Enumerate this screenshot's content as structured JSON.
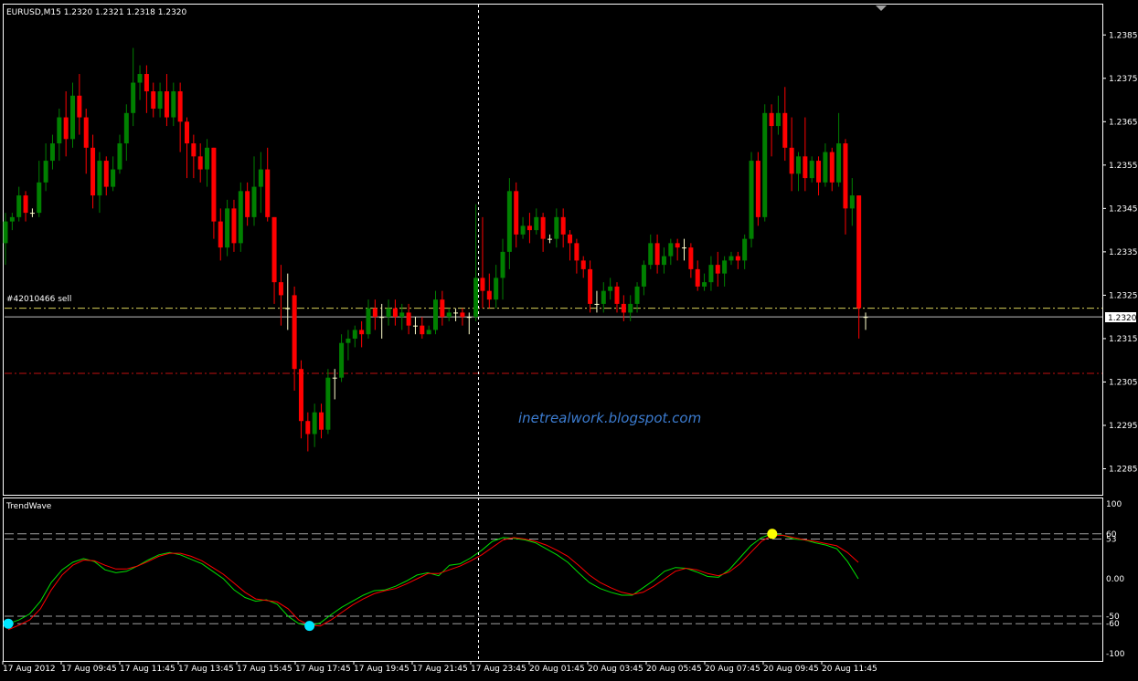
{
  "window": {
    "symbol_label": "EURUSD,M15  1.2320 1.2321 1.2318 1.2320",
    "order_label": "#42010466 sell",
    "price_tag": "1.2320",
    "watermark": "inetrealwork.blogspot.com",
    "indicator_label": "TrendWave"
  },
  "colors": {
    "background": "#000000",
    "frame": "#ffffff",
    "bull_candle": "#008000",
    "bear_candle": "#ff0000",
    "doji": "#ffffcc",
    "order_line": "#d6d05a",
    "stop_line": "#c01010",
    "bid_line": "#c0c0c0",
    "crosshair": "#ffffff",
    "watermark": "#3c7cd0",
    "wave_fast": "#00e000",
    "wave_slow": "#ff0000",
    "level_line": "#a0a0a0",
    "buy_dot": "#00e5ff",
    "sell_dot": "#ffff00"
  },
  "chart_data": [
    {
      "type": "candlestick",
      "title": "EURUSD,M15  1.2320 1.2321 1.2318 1.2320",
      "ylim": [
        1.2279,
        1.2392
      ],
      "y_ticks": [
        "1.2385",
        "1.2375",
        "1.2365",
        "1.2355",
        "1.2345",
        "1.2335",
        "1.2325",
        "1.2315",
        "1.2305",
        "1.2295",
        "1.2285"
      ],
      "x_tick_labels": [
        "17 Aug 2012",
        "17 Aug 09:45",
        "17 Aug 11:45",
        "17 Aug 13:45",
        "17 Aug 15:45",
        "17 Aug 17:45",
        "17 Aug 19:45",
        "17 Aug 21:45",
        "17 Aug 23:45",
        "20 Aug 01:45",
        "20 Aug 03:45",
        "20 Aug 05:45",
        "20 Aug 07:45",
        "20 Aug 09:45",
        "20 Aug 11:45"
      ],
      "levels": {
        "order_sell": 1.2322,
        "stop": 1.2307,
        "bid": 1.232
      },
      "candles": [
        [
          1.2337,
          1.2342,
          1.2332,
          1.2344
        ],
        [
          1.2342,
          1.2343,
          1.234,
          1.2344
        ],
        [
          1.2343,
          1.2348,
          1.2342,
          1.235
        ],
        [
          1.2348,
          1.2344,
          1.2342,
          1.2349
        ],
        [
          1.2344,
          1.2344,
          1.2343,
          1.2345
        ],
        [
          1.2344,
          1.2351,
          1.2343,
          1.2356
        ],
        [
          1.2351,
          1.2356,
          1.2349,
          1.236
        ],
        [
          1.2356,
          1.236,
          1.2354,
          1.2362
        ],
        [
          1.236,
          1.2366,
          1.2356,
          1.2368
        ],
        [
          1.2366,
          1.2361,
          1.2357,
          1.2372
        ],
        [
          1.2361,
          1.2371,
          1.2359,
          1.2374
        ],
        [
          1.2371,
          1.2366,
          1.2362,
          1.2376
        ],
        [
          1.2366,
          1.2359,
          1.2353,
          1.2368
        ],
        [
          1.2359,
          1.2348,
          1.2345,
          1.2362
        ],
        [
          1.2348,
          1.2356,
          1.2344,
          1.2358
        ],
        [
          1.2356,
          1.235,
          1.2348,
          1.2357
        ],
        [
          1.235,
          1.2354,
          1.2349,
          1.2357
        ],
        [
          1.2354,
          1.236,
          1.2353,
          1.2362
        ],
        [
          1.236,
          1.2367,
          1.2356,
          1.2369
        ],
        [
          1.2367,
          1.2374,
          1.2364,
          1.2382
        ],
        [
          1.2374,
          1.2376,
          1.237,
          1.2378
        ],
        [
          1.2376,
          1.2372,
          1.2367,
          1.2378
        ],
        [
          1.2372,
          1.2368,
          1.2366,
          1.2374
        ],
        [
          1.2368,
          1.2372,
          1.2366,
          1.2374
        ],
        [
          1.2372,
          1.2366,
          1.2364,
          1.2376
        ],
        [
          1.2366,
          1.2372,
          1.2364,
          1.2374
        ],
        [
          1.2372,
          1.2365,
          1.2358,
          1.2374
        ],
        [
          1.2365,
          1.236,
          1.2352,
          1.2366
        ],
        [
          1.236,
          1.2357,
          1.2352,
          1.2362
        ],
        [
          1.2357,
          1.2354,
          1.2351,
          1.236
        ],
        [
          1.2354,
          1.2359,
          1.235,
          1.2361
        ],
        [
          1.2359,
          1.2342,
          1.2338,
          1.2359
        ],
        [
          1.2342,
          1.2336,
          1.2333,
          1.2345
        ],
        [
          1.2336,
          1.2345,
          1.2334,
          1.2347
        ],
        [
          1.2345,
          1.2337,
          1.2335,
          1.2347
        ],
        [
          1.2337,
          1.2349,
          1.2335,
          1.2351
        ],
        [
          1.2349,
          1.2343,
          1.2341,
          1.2351
        ],
        [
          1.2343,
          1.235,
          1.2341,
          1.2357
        ],
        [
          1.235,
          1.2354,
          1.2344,
          1.2358
        ],
        [
          1.2354,
          1.2343,
          1.2342,
          1.2359
        ],
        [
          1.2343,
          1.2328,
          1.2323,
          1.2343
        ],
        [
          1.2328,
          1.2325,
          1.2318,
          1.2332
        ],
        [
          1.2322,
          1.2322,
          1.2317,
          1.233
        ],
        [
          1.2325,
          1.2308,
          1.2303,
          1.2327
        ],
        [
          1.2308,
          1.2296,
          1.2292,
          1.231
        ],
        [
          1.2296,
          1.2293,
          1.2289,
          1.2298
        ],
        [
          1.2293,
          1.2298,
          1.229,
          1.23
        ],
        [
          1.2298,
          1.2294,
          1.2292,
          1.23
        ],
        [
          1.2294,
          1.2306,
          1.2293,
          1.2308
        ],
        [
          1.2306,
          1.2306,
          1.2301,
          1.2308
        ],
        [
          1.2306,
          1.2314,
          1.2305,
          1.2316
        ],
        [
          1.2314,
          1.2315,
          1.231,
          1.2317
        ],
        [
          1.2315,
          1.2317,
          1.2313,
          1.2318
        ],
        [
          1.2317,
          1.2316,
          1.2313,
          1.2319
        ],
        [
          1.2316,
          1.2322,
          1.2315,
          1.2324
        ],
        [
          1.2322,
          1.232,
          1.2317,
          1.2324
        ],
        [
          1.232,
          1.232,
          1.2315,
          1.2323
        ],
        [
          1.232,
          1.2322,
          1.2318,
          1.2324
        ],
        [
          1.2322,
          1.232,
          1.2318,
          1.2324
        ],
        [
          1.232,
          1.2321,
          1.2317,
          1.2323
        ],
        [
          1.2321,
          1.2318,
          1.2316,
          1.2323
        ],
        [
          1.2318,
          1.2318,
          1.2316,
          1.232
        ],
        [
          1.2318,
          1.2316,
          1.2315,
          1.232
        ],
        [
          1.2316,
          1.2317,
          1.2316,
          1.2318
        ],
        [
          1.2317,
          1.2324,
          1.2316,
          1.2326
        ],
        [
          1.2324,
          1.232,
          1.2318,
          1.2326
        ],
        [
          1.232,
          1.2321,
          1.2319,
          1.2322
        ],
        [
          1.2321,
          1.2321,
          1.2319,
          1.2322
        ],
        [
          1.2321,
          1.232,
          1.2318,
          1.2322
        ],
        [
          1.232,
          1.232,
          1.2316,
          1.2321
        ],
        [
          1.232,
          1.2329,
          1.2319,
          1.2346
        ],
        [
          1.2329,
          1.2326,
          1.2322,
          1.2343
        ],
        [
          1.2326,
          1.2324,
          1.2322,
          1.233
        ],
        [
          1.2324,
          1.2329,
          1.2322,
          1.2332
        ],
        [
          1.2329,
          1.2335,
          1.2324,
          1.2338
        ],
        [
          1.2335,
          1.2349,
          1.2331,
          1.2352
        ],
        [
          1.2349,
          1.2339,
          1.2336,
          1.2351
        ],
        [
          1.2339,
          1.2341,
          1.2338,
          1.2343
        ],
        [
          1.2341,
          1.234,
          1.2337,
          1.2344
        ],
        [
          1.234,
          1.2343,
          1.2339,
          1.2345
        ],
        [
          1.2343,
          1.2338,
          1.2335,
          1.2344
        ],
        [
          1.2338,
          1.2338,
          1.2337,
          1.2339
        ],
        [
          1.2338,
          1.2343,
          1.2336,
          1.2345
        ],
        [
          1.2343,
          1.2339,
          1.2336,
          1.2345
        ],
        [
          1.2339,
          1.2337,
          1.2333,
          1.234
        ],
        [
          1.2337,
          1.2333,
          1.233,
          1.2338
        ],
        [
          1.2333,
          1.2331,
          1.2329,
          1.2334
        ],
        [
          1.2331,
          1.2323,
          1.2321,
          1.2333
        ],
        [
          1.2323,
          1.2323,
          1.2321,
          1.2326
        ],
        [
          1.2323,
          1.2326,
          1.2321,
          1.2328
        ],
        [
          1.2326,
          1.2327,
          1.2324,
          1.2329
        ],
        [
          1.2327,
          1.2323,
          1.2321,
          1.2328
        ],
        [
          1.2323,
          1.2321,
          1.2319,
          1.2325
        ],
        [
          1.2321,
          1.2323,
          1.2319,
          1.2325
        ],
        [
          1.2323,
          1.2327,
          1.2321,
          1.2328
        ],
        [
          1.2327,
          1.2332,
          1.2325,
          1.2333
        ],
        [
          1.2332,
          1.2337,
          1.2331,
          1.2339
        ],
        [
          1.2337,
          1.2332,
          1.233,
          1.2339
        ],
        [
          1.2332,
          1.2334,
          1.233,
          1.2336
        ],
        [
          1.2334,
          1.2337,
          1.2332,
          1.2338
        ],
        [
          1.2337,
          1.2336,
          1.2333,
          1.2338
        ],
        [
          1.2336,
          1.2336,
          1.2333,
          1.2338
        ],
        [
          1.2336,
          1.2331,
          1.2329,
          1.2337
        ],
        [
          1.2331,
          1.2327,
          1.2326,
          1.2333
        ],
        [
          1.2327,
          1.2328,
          1.2326,
          1.233
        ],
        [
          1.2328,
          1.2332,
          1.2326,
          1.2334
        ],
        [
          1.2332,
          1.233,
          1.2327,
          1.2335
        ],
        [
          1.233,
          1.2333,
          1.2327,
          1.2334
        ],
        [
          1.2333,
          1.2334,
          1.2332,
          1.2335
        ],
        [
          1.2334,
          1.2333,
          1.2331,
          1.2335
        ],
        [
          1.2333,
          1.2338,
          1.2331,
          1.2339
        ],
        [
          1.2338,
          1.2356,
          1.2336,
          1.2358
        ],
        [
          1.2356,
          1.2343,
          1.2341,
          1.2358
        ],
        [
          1.2343,
          1.2367,
          1.2342,
          1.2369
        ],
        [
          1.2367,
          1.2364,
          1.2357,
          1.2369
        ],
        [
          1.2364,
          1.2367,
          1.2362,
          1.2371
        ],
        [
          1.2367,
          1.2359,
          1.2356,
          1.2373
        ],
        [
          1.2359,
          1.2353,
          1.2349,
          1.2366
        ],
        [
          1.2353,
          1.2357,
          1.2349,
          1.2358
        ],
        [
          1.2357,
          1.2352,
          1.2349,
          1.2366
        ],
        [
          1.2352,
          1.2356,
          1.2351,
          1.2357
        ],
        [
          1.2356,
          1.2351,
          1.2348,
          1.2357
        ],
        [
          1.2351,
          1.2358,
          1.235,
          1.236
        ],
        [
          1.2358,
          1.2351,
          1.2349,
          1.2359
        ],
        [
          1.2351,
          1.236,
          1.235,
          1.2367
        ],
        [
          1.236,
          1.2345,
          1.2339,
          1.2361
        ],
        [
          1.2345,
          1.2348,
          1.2341,
          1.2352
        ],
        [
          1.2348,
          1.2322,
          1.2315,
          1.2348
        ],
        [
          1.232,
          1.232,
          1.2317,
          1.2321
        ]
      ]
    },
    {
      "type": "line",
      "title": "TrendWave",
      "ylim": [
        -100,
        100
      ],
      "y_ticks": [
        "100",
        "60",
        "53",
        "0.00",
        "-50",
        "-60",
        "-100"
      ],
      "levels": [
        60,
        53,
        -50,
        -60
      ],
      "series": [
        {
          "values": [
            -60,
            -55,
            -47,
            -30,
            -5,
            12,
            22,
            27,
            23,
            12,
            8,
            10,
            17,
            25,
            32,
            35,
            32,
            26,
            20,
            10,
            0,
            -15,
            -25,
            -30,
            -28,
            -34,
            -50,
            -60,
            -63,
            -59,
            -48,
            -38,
            -30,
            -22,
            -16,
            -15,
            -10,
            -3,
            5,
            8,
            4,
            18,
            20,
            28,
            38,
            50,
            55,
            54,
            52,
            48,
            40,
            32,
            22,
            8,
            -5,
            -13,
            -18,
            -22,
            -22,
            -12,
            -2,
            10,
            15,
            14,
            9,
            3,
            2,
            12,
            28,
            44,
            55,
            60,
            58,
            53,
            52,
            48,
            45,
            40,
            23,
            0
          ]
        },
        {
          "values": [
            -68,
            -62,
            -55,
            -40,
            -15,
            5,
            18,
            25,
            24,
            18,
            13,
            13,
            17,
            23,
            30,
            34,
            34,
            30,
            24,
            15,
            6,
            -6,
            -18,
            -27,
            -29,
            -31,
            -40,
            -55,
            -62,
            -63,
            -55,
            -45,
            -35,
            -27,
            -20,
            -16,
            -13,
            -7,
            0,
            7,
            7,
            12,
            17,
            24,
            32,
            42,
            52,
            55,
            53,
            50,
            45,
            38,
            30,
            18,
            5,
            -5,
            -12,
            -18,
            -21,
            -18,
            -10,
            0,
            10,
            14,
            12,
            7,
            4,
            9,
            20,
            35,
            50,
            58,
            58,
            55,
            52,
            50,
            47,
            44,
            35,
            22
          ]
        }
      ],
      "markers": [
        {
          "series_index": 0,
          "value": -60,
          "type": "buy"
        },
        {
          "series_index": 0,
          "value": -63,
          "type": "buy"
        },
        {
          "series_index": 0,
          "value": 60,
          "type": "sell"
        }
      ]
    }
  ]
}
